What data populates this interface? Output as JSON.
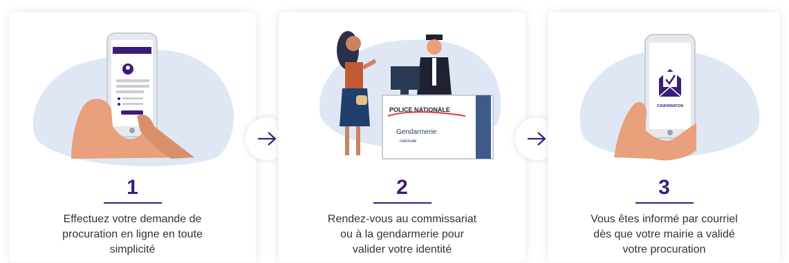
{
  "steps": [
    {
      "number": "1",
      "description": [
        "Effectuez votre demande de",
        "procuration en ligne en toute",
        "simplicité"
      ],
      "illustration": "hand-holding-phone-form-illustration"
    },
    {
      "number": "2",
      "description": [
        "Rendez-vous au commissariat",
        "ou à la gendarmerie pour",
        "valider votre identité"
      ],
      "illustration": "police-desk-illustration",
      "sign_police": "POLICE NATIONALE",
      "sign_gendarmerie": "Gendarmerie",
      "sign_gendarmerie_sub": "nationale"
    },
    {
      "number": "3",
      "description": [
        "Vous êtes informé par courriel",
        "dès que votre mairie a validé",
        "votre procuration"
      ],
      "illustration": "hand-holding-phone-confirmation-illustration",
      "phone_label": "CONFIRMATION"
    }
  ],
  "arrows": [
    "arrow-right-icon",
    "arrow-right-icon"
  ],
  "colors": {
    "accent": "#3c1c7a",
    "blob": "#dfe7f4",
    "skin": "#e8a17c",
    "text": "#333333"
  }
}
